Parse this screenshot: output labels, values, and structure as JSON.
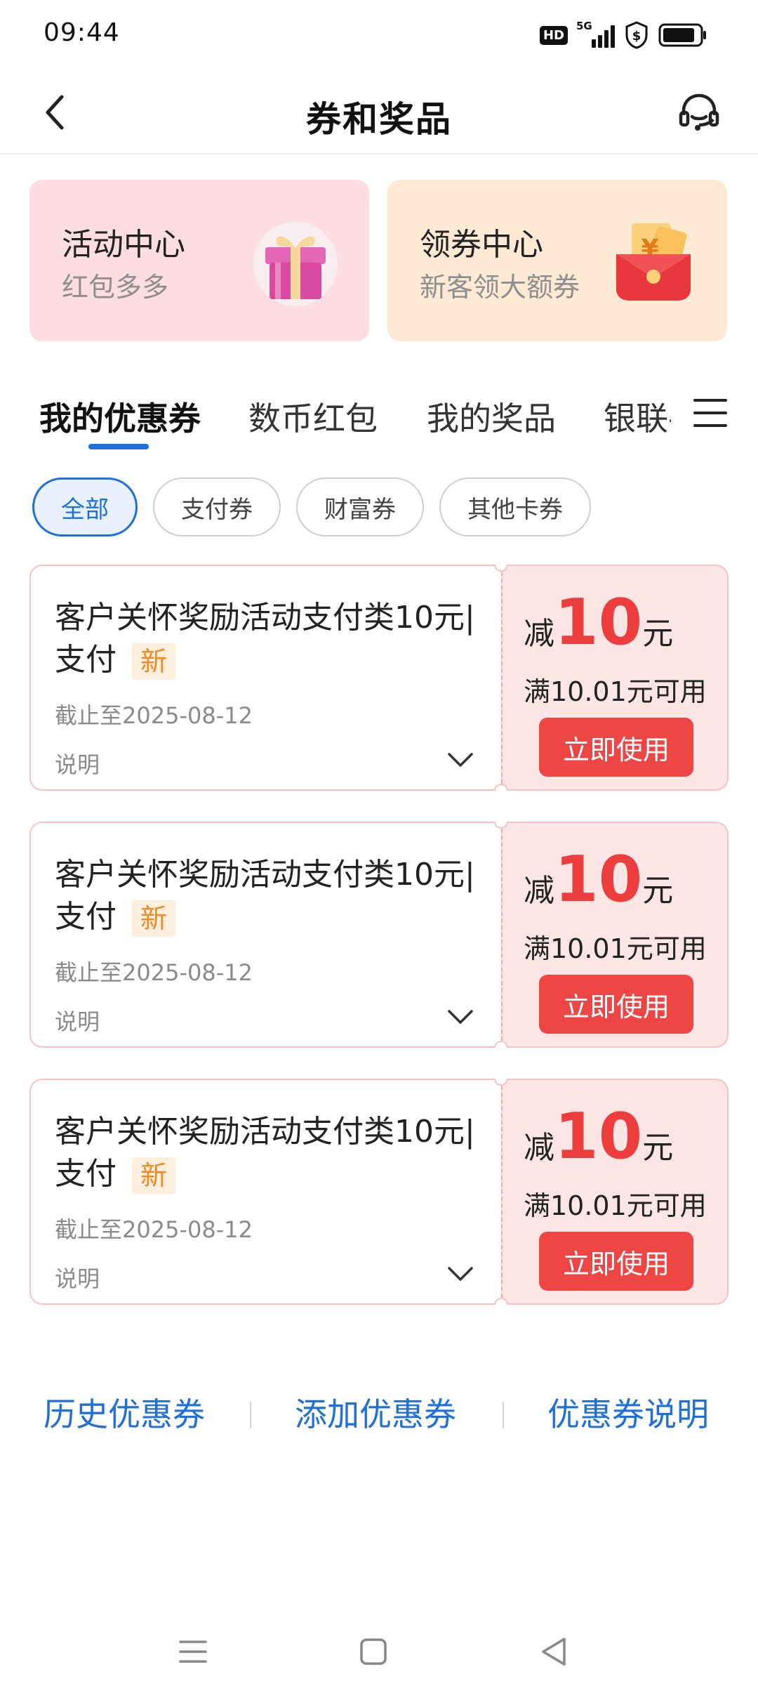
{
  "status_bar": {
    "time": "09:44",
    "hd_badge": "HD",
    "network": "5G",
    "icons": [
      "hd-icon",
      "signal-5g-icon",
      "shield-dollar-icon",
      "battery-icon"
    ]
  },
  "header": {
    "title": "券和奖品",
    "back_icon": "chevron-left-icon",
    "service_icon": "headset-icon"
  },
  "banners": [
    {
      "title": "活动中心",
      "subtitle": "红包多多",
      "icon": "gift-box-icon",
      "color": "#fcdde2"
    },
    {
      "title": "领券中心",
      "subtitle": "新客领大额券",
      "icon": "red-envelope-icon",
      "color": "#fde9d4"
    }
  ],
  "tabs": {
    "items": [
      "我的优惠券",
      "数币红包",
      "我的奖品",
      "银联-"
    ],
    "active_index": 0,
    "menu_icon": "menu-icon"
  },
  "filters": {
    "items": [
      "全部",
      "支付券",
      "财富券",
      "其他卡券"
    ],
    "active_index": 0
  },
  "coupons": [
    {
      "title": "客户关怀奖励活动支付类10元|支付",
      "badge": "新",
      "expiry": "截止至2025-08-12",
      "desc_label": "说明",
      "reduce_label": "减",
      "amount": "10",
      "unit": "元",
      "condition": "满10.01元可用",
      "action": "立即使用"
    },
    {
      "title": "客户关怀奖励活动支付类10元|支付",
      "badge": "新",
      "expiry": "截止至2025-08-12",
      "desc_label": "说明",
      "reduce_label": "减",
      "amount": "10",
      "unit": "元",
      "condition": "满10.01元可用",
      "action": "立即使用"
    },
    {
      "title": "客户关怀奖励活动支付类10元|支付",
      "badge": "新",
      "expiry": "截止至2025-08-12",
      "desc_label": "说明",
      "reduce_label": "减",
      "amount": "10",
      "unit": "元",
      "condition": "满10.01元可用",
      "action": "立即使用"
    }
  ],
  "footer": {
    "links": [
      "历史优惠券",
      "添加优惠券",
      "优惠券说明"
    ]
  },
  "colors": {
    "accent": "#1e6fd9",
    "coupon_red": "#ee3d3d",
    "badge_orange": "#f08a24"
  }
}
